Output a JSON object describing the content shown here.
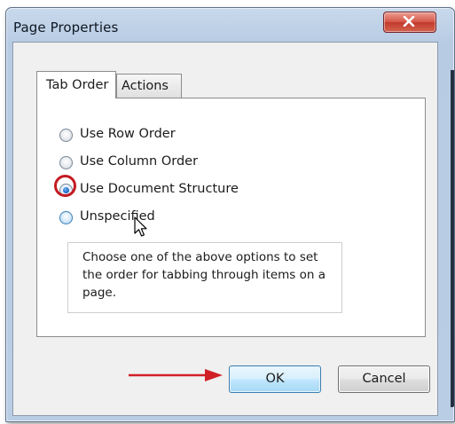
{
  "window": {
    "title": "Page Properties",
    "close_icon": "close-x-icon"
  },
  "tabs": [
    {
      "label": "Tab Order",
      "selected": true
    },
    {
      "label": "Actions",
      "selected": false
    }
  ],
  "tab_order": {
    "options": [
      {
        "label": "Use Row Order",
        "selected": false
      },
      {
        "label": "Use Column Order",
        "selected": false
      },
      {
        "label": "Use Document Structure",
        "selected": true
      },
      {
        "label": "Unspecified",
        "selected": false
      }
    ],
    "description": "Choose one of the above options to set the order for tabbing through items on a page."
  },
  "buttons": {
    "ok_label": "OK",
    "cancel_label": "Cancel"
  },
  "annotations": {
    "highlight_color": "#c41a21",
    "ring_target": "Use Document Structure",
    "arrow_target": "OK"
  },
  "colors": {
    "window_frame": "#b9cde4",
    "close_button": "#c94535",
    "ok_button_border": "#3c7fb1",
    "dialog_background": "#f0f0f0"
  }
}
